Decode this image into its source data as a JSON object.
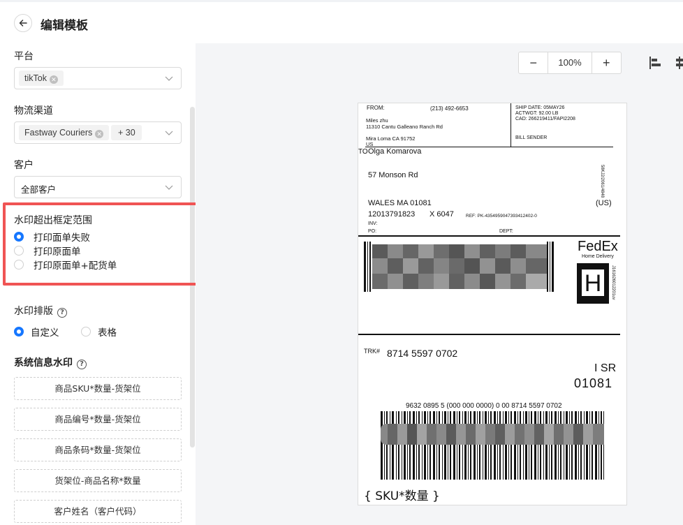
{
  "header": {
    "title": "编辑模板",
    "back_icon": "arrow-left-icon"
  },
  "sidebar": {
    "platform": {
      "label": "平台",
      "tags": [
        "tikTok"
      ]
    },
    "channel": {
      "label": "物流渠道",
      "tags": [
        "Fastway Couriers"
      ],
      "more": "+ 30"
    },
    "customer": {
      "label": "客户",
      "value": "全部客户"
    },
    "overflow": {
      "label": "水印超出框定范围",
      "options": [
        "打印面单失败",
        "打印原面单",
        "打印原面单+配货单"
      ],
      "selected": 0
    },
    "layout": {
      "label": "水印排版",
      "options": [
        "自定义",
        "表格"
      ],
      "selected": 0
    },
    "system_watermark": {
      "label": "系统信息水印",
      "buttons": [
        "商品SKU*数量-货架位",
        "商品编号*数量-货架位",
        "商品条码*数量-货架位",
        "货架位-商品名称*数量",
        "客户姓名（客户代码）"
      ]
    }
  },
  "toolbar": {
    "zoom": "100%",
    "minus": "−",
    "plus": "+"
  },
  "label": {
    "from": "FROM:",
    "from_phone": "(213) 492-6653",
    "from_name": "Miles zhu",
    "from_addr1": "11310 Cantu Galleano Ranch Rd",
    "from_addr2": "Mira Loma CA 91752",
    "from_country": "US",
    "ship_date": "SHIP DATE: 05MAY26",
    "actwgt": "ACTWGT: 92.00 LB",
    "cad": "CAD: 266219411/FAPI2208",
    "bill": "BILL SENDER",
    "to": "TO",
    "to_name": "Olga Komarova",
    "to_addr1": "57 Monson Rd",
    "to_city": "WALES MA 01081",
    "to_us": "(US)",
    "to_phone": "12013791823",
    "to_ext": "X 6047",
    "ref": "REF: PK-4354959047393412402-0",
    "inv": "INV:",
    "po": "PO:",
    "dept": "DEPT:",
    "side_code": "58KJ2/2061/4848",
    "fedex": "FedEx",
    "home_delivery": "Home Delivery",
    "h": "H",
    "side_code2": "J161626012201uv",
    "trk_label": "TRK#",
    "trk": "8714 5597 0702",
    "isr": "I SR",
    "zip": "01081",
    "barcode_text": "9632 0895 5 (000 000 0000) 0 00 8714 5597 0702",
    "sku_placeholder": "{ SKU*数量 }"
  }
}
